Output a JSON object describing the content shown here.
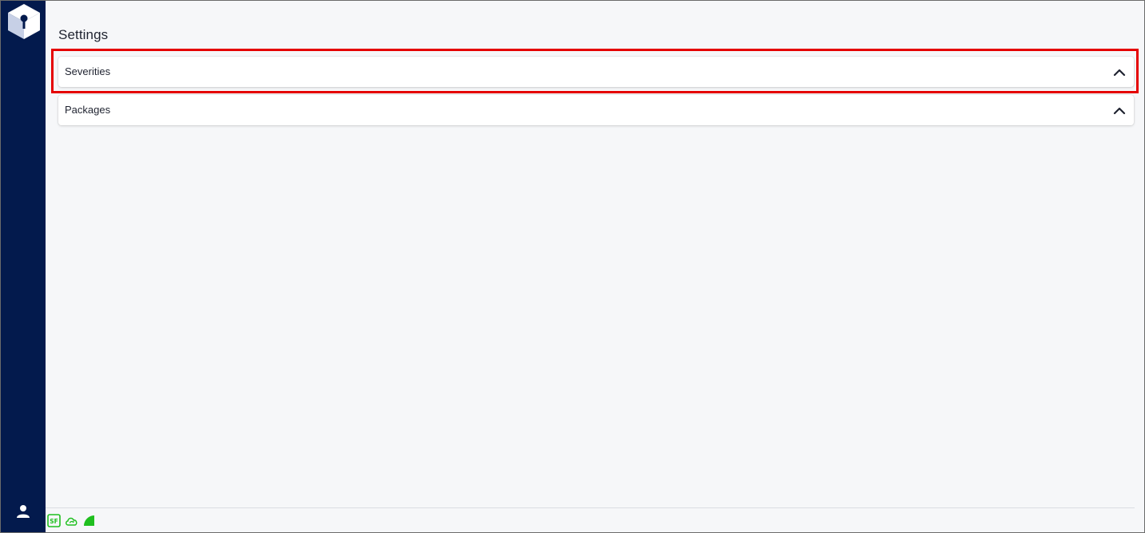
{
  "app": {
    "logo_icon": "cube-logo-icon",
    "user_icon": "user-icon"
  },
  "main": {
    "title": "Settings"
  },
  "panels": [
    {
      "label": "Severities",
      "icon": "chevron-up-icon",
      "highlighted": true
    },
    {
      "label": "Packages",
      "icon": "chevron-up-icon",
      "highlighted": false
    }
  ],
  "status_bar": {
    "icons": [
      "sf-badge-icon",
      "cloud-sync-icon",
      "signal-icon"
    ],
    "status_color": "#1fbf1f"
  },
  "colors": {
    "sidebar": "#031a4d",
    "background": "#f6f7f9",
    "highlight": "#e50000"
  }
}
